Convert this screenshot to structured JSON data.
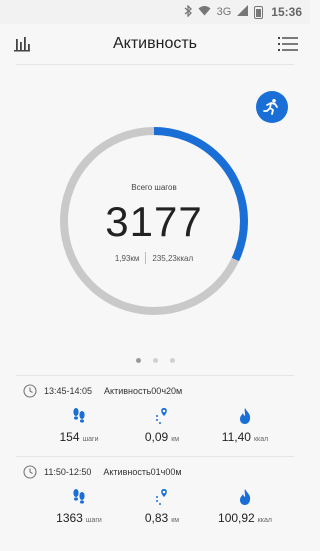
{
  "status": {
    "network": "3G",
    "time": "15:36"
  },
  "header": {
    "title": "Активность"
  },
  "summary": {
    "label": "Всего шагов",
    "steps": "3177",
    "distance": "1,93км",
    "calories": "235,23ккал",
    "progress_fraction": 0.32,
    "accent_color": "#1a6fd6"
  },
  "pager": {
    "count": 3,
    "active_index": 0
  },
  "sessions": [
    {
      "time": "13:45-14:05",
      "activity": "Активность00ч20м",
      "steps": "154",
      "steps_unit": "шаги",
      "distance": "0,09",
      "distance_unit": "км",
      "calories": "11,40",
      "calories_unit": "ккал"
    },
    {
      "time": "11:50-12:50",
      "activity": "Активность01ч00м",
      "steps": "1363",
      "steps_unit": "шаги",
      "distance": "0,83",
      "distance_unit": "км",
      "calories": "100,92",
      "calories_unit": "ккал"
    }
  ]
}
